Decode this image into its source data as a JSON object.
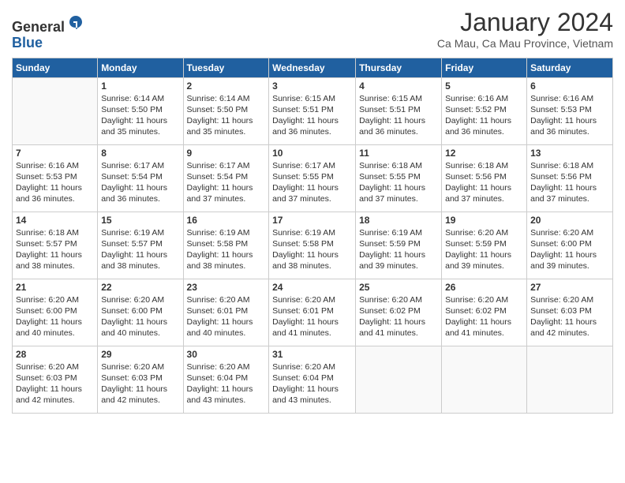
{
  "logo": {
    "general": "General",
    "blue": "Blue"
  },
  "title": "January 2024",
  "location": "Ca Mau, Ca Mau Province, Vietnam",
  "days_of_week": [
    "Sunday",
    "Monday",
    "Tuesday",
    "Wednesday",
    "Thursday",
    "Friday",
    "Saturday"
  ],
  "weeks": [
    [
      {
        "day": "",
        "sunrise": "",
        "sunset": "",
        "daylight": ""
      },
      {
        "day": "1",
        "sunrise": "Sunrise: 6:14 AM",
        "sunset": "Sunset: 5:50 PM",
        "daylight": "Daylight: 11 hours and 35 minutes."
      },
      {
        "day": "2",
        "sunrise": "Sunrise: 6:14 AM",
        "sunset": "Sunset: 5:50 PM",
        "daylight": "Daylight: 11 hours and 35 minutes."
      },
      {
        "day": "3",
        "sunrise": "Sunrise: 6:15 AM",
        "sunset": "Sunset: 5:51 PM",
        "daylight": "Daylight: 11 hours and 36 minutes."
      },
      {
        "day": "4",
        "sunrise": "Sunrise: 6:15 AM",
        "sunset": "Sunset: 5:51 PM",
        "daylight": "Daylight: 11 hours and 36 minutes."
      },
      {
        "day": "5",
        "sunrise": "Sunrise: 6:16 AM",
        "sunset": "Sunset: 5:52 PM",
        "daylight": "Daylight: 11 hours and 36 minutes."
      },
      {
        "day": "6",
        "sunrise": "Sunrise: 6:16 AM",
        "sunset": "Sunset: 5:53 PM",
        "daylight": "Daylight: 11 hours and 36 minutes."
      }
    ],
    [
      {
        "day": "7",
        "sunrise": "Sunrise: 6:16 AM",
        "sunset": "Sunset: 5:53 PM",
        "daylight": "Daylight: 11 hours and 36 minutes."
      },
      {
        "day": "8",
        "sunrise": "Sunrise: 6:17 AM",
        "sunset": "Sunset: 5:54 PM",
        "daylight": "Daylight: 11 hours and 36 minutes."
      },
      {
        "day": "9",
        "sunrise": "Sunrise: 6:17 AM",
        "sunset": "Sunset: 5:54 PM",
        "daylight": "Daylight: 11 hours and 37 minutes."
      },
      {
        "day": "10",
        "sunrise": "Sunrise: 6:17 AM",
        "sunset": "Sunset: 5:55 PM",
        "daylight": "Daylight: 11 hours and 37 minutes."
      },
      {
        "day": "11",
        "sunrise": "Sunrise: 6:18 AM",
        "sunset": "Sunset: 5:55 PM",
        "daylight": "Daylight: 11 hours and 37 minutes."
      },
      {
        "day": "12",
        "sunrise": "Sunrise: 6:18 AM",
        "sunset": "Sunset: 5:56 PM",
        "daylight": "Daylight: 11 hours and 37 minutes."
      },
      {
        "day": "13",
        "sunrise": "Sunrise: 6:18 AM",
        "sunset": "Sunset: 5:56 PM",
        "daylight": "Daylight: 11 hours and 37 minutes."
      }
    ],
    [
      {
        "day": "14",
        "sunrise": "Sunrise: 6:18 AM",
        "sunset": "Sunset: 5:57 PM",
        "daylight": "Daylight: 11 hours and 38 minutes."
      },
      {
        "day": "15",
        "sunrise": "Sunrise: 6:19 AM",
        "sunset": "Sunset: 5:57 PM",
        "daylight": "Daylight: 11 hours and 38 minutes."
      },
      {
        "day": "16",
        "sunrise": "Sunrise: 6:19 AM",
        "sunset": "Sunset: 5:58 PM",
        "daylight": "Daylight: 11 hours and 38 minutes."
      },
      {
        "day": "17",
        "sunrise": "Sunrise: 6:19 AM",
        "sunset": "Sunset: 5:58 PM",
        "daylight": "Daylight: 11 hours and 38 minutes."
      },
      {
        "day": "18",
        "sunrise": "Sunrise: 6:19 AM",
        "sunset": "Sunset: 5:59 PM",
        "daylight": "Daylight: 11 hours and 39 minutes."
      },
      {
        "day": "19",
        "sunrise": "Sunrise: 6:20 AM",
        "sunset": "Sunset: 5:59 PM",
        "daylight": "Daylight: 11 hours and 39 minutes."
      },
      {
        "day": "20",
        "sunrise": "Sunrise: 6:20 AM",
        "sunset": "Sunset: 6:00 PM",
        "daylight": "Daylight: 11 hours and 39 minutes."
      }
    ],
    [
      {
        "day": "21",
        "sunrise": "Sunrise: 6:20 AM",
        "sunset": "Sunset: 6:00 PM",
        "daylight": "Daylight: 11 hours and 40 minutes."
      },
      {
        "day": "22",
        "sunrise": "Sunrise: 6:20 AM",
        "sunset": "Sunset: 6:00 PM",
        "daylight": "Daylight: 11 hours and 40 minutes."
      },
      {
        "day": "23",
        "sunrise": "Sunrise: 6:20 AM",
        "sunset": "Sunset: 6:01 PM",
        "daylight": "Daylight: 11 hours and 40 minutes."
      },
      {
        "day": "24",
        "sunrise": "Sunrise: 6:20 AM",
        "sunset": "Sunset: 6:01 PM",
        "daylight": "Daylight: 11 hours and 41 minutes."
      },
      {
        "day": "25",
        "sunrise": "Sunrise: 6:20 AM",
        "sunset": "Sunset: 6:02 PM",
        "daylight": "Daylight: 11 hours and 41 minutes."
      },
      {
        "day": "26",
        "sunrise": "Sunrise: 6:20 AM",
        "sunset": "Sunset: 6:02 PM",
        "daylight": "Daylight: 11 hours and 41 minutes."
      },
      {
        "day": "27",
        "sunrise": "Sunrise: 6:20 AM",
        "sunset": "Sunset: 6:03 PM",
        "daylight": "Daylight: 11 hours and 42 minutes."
      }
    ],
    [
      {
        "day": "28",
        "sunrise": "Sunrise: 6:20 AM",
        "sunset": "Sunset: 6:03 PM",
        "daylight": "Daylight: 11 hours and 42 minutes."
      },
      {
        "day": "29",
        "sunrise": "Sunrise: 6:20 AM",
        "sunset": "Sunset: 6:03 PM",
        "daylight": "Daylight: 11 hours and 42 minutes."
      },
      {
        "day": "30",
        "sunrise": "Sunrise: 6:20 AM",
        "sunset": "Sunset: 6:04 PM",
        "daylight": "Daylight: 11 hours and 43 minutes."
      },
      {
        "day": "31",
        "sunrise": "Sunrise: 6:20 AM",
        "sunset": "Sunset: 6:04 PM",
        "daylight": "Daylight: 11 hours and 43 minutes."
      },
      {
        "day": "",
        "sunrise": "",
        "sunset": "",
        "daylight": ""
      },
      {
        "day": "",
        "sunrise": "",
        "sunset": "",
        "daylight": ""
      },
      {
        "day": "",
        "sunrise": "",
        "sunset": "",
        "daylight": ""
      }
    ]
  ]
}
